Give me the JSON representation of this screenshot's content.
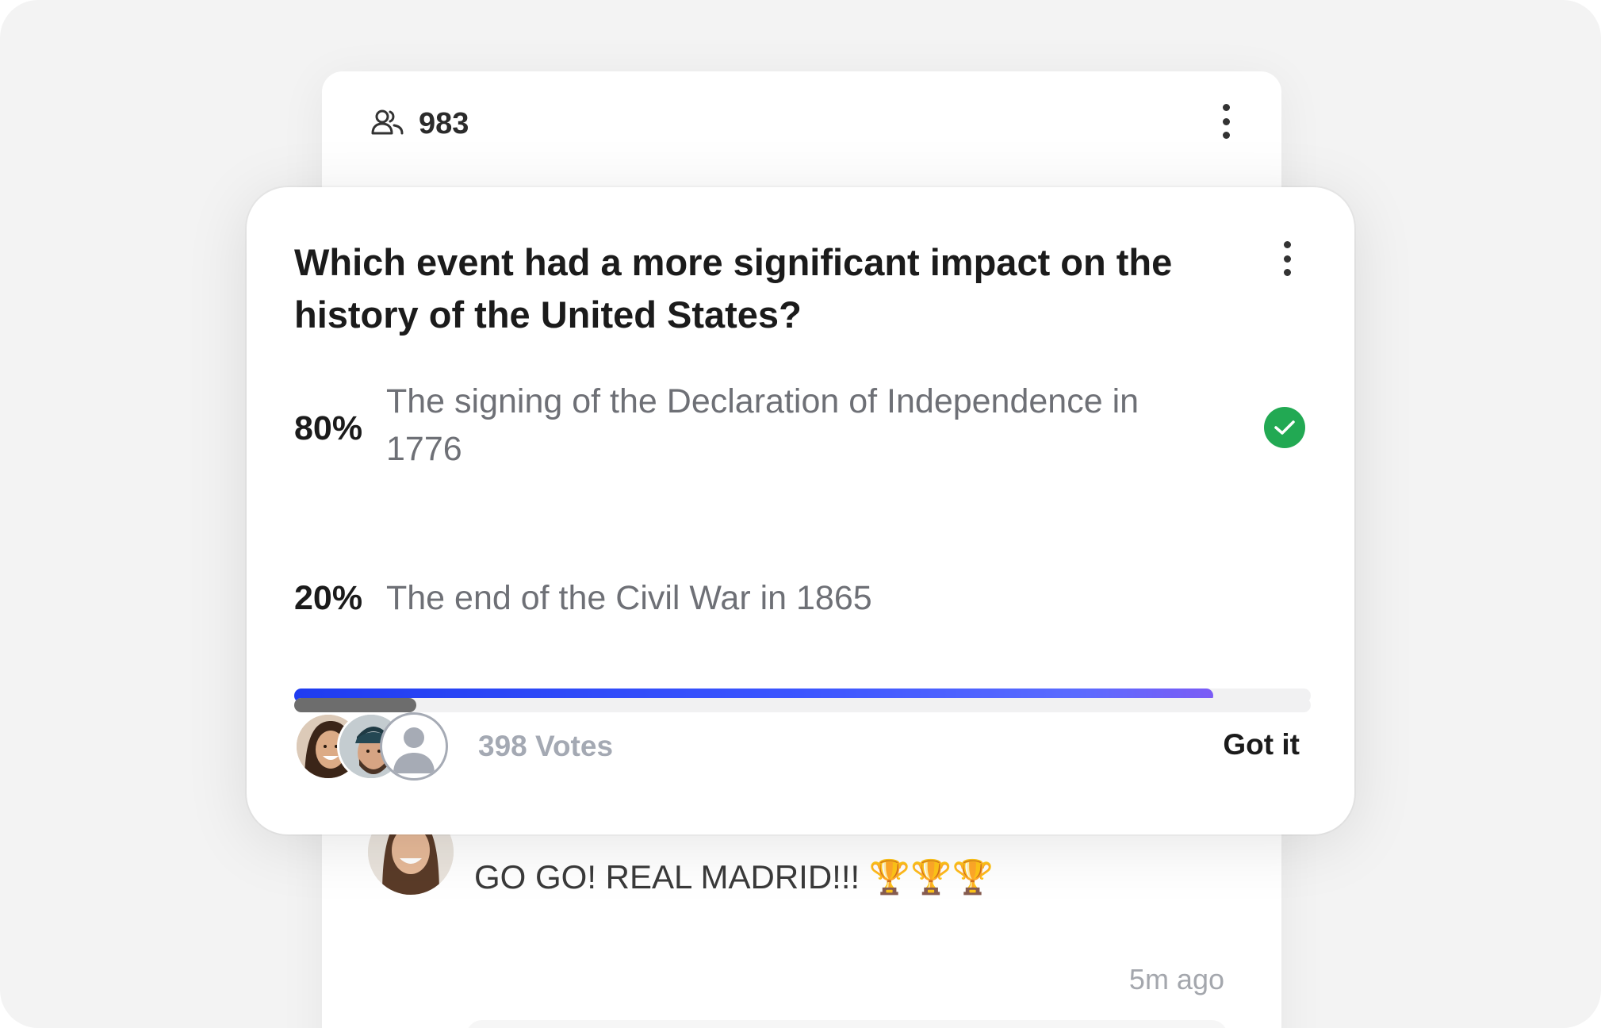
{
  "chat": {
    "participants_count": "983",
    "message_text": "GO GO! REAL MADRID!!! 🏆🏆🏆",
    "timestamp": "5m ago"
  },
  "poll": {
    "question": "Which event had a more significant impact on the history of the United States?",
    "options": [
      {
        "percent_label": "80%",
        "text": "The signing of the Declaration of Independence in 1776",
        "fill_fraction": 0.8,
        "selected": true
      },
      {
        "percent_label": "20%",
        "text": "The end of the Civil War in 1865",
        "fill_fraction": 0.2,
        "selected": false
      }
    ],
    "votes_label": "398 Votes",
    "dismiss_label": "Got it"
  },
  "icons": {
    "participants": "users-icon",
    "more": "more-vertical-icon",
    "selected": "check-circle-icon",
    "default_avatar": "user-placeholder-icon"
  },
  "colors": {
    "accent_start": "#1f3cf0",
    "accent_end": "#7b5cf5",
    "check_green": "#22a953",
    "secondary_fill": "#6d6d6d"
  }
}
